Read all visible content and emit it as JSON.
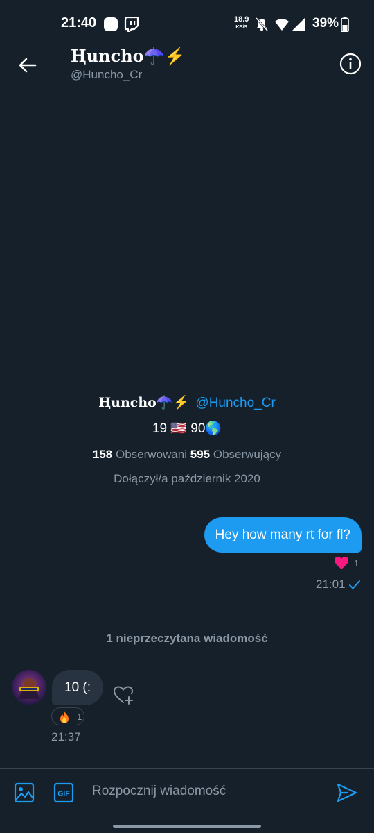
{
  "status_bar": {
    "time": "21:40",
    "net_speed_value": "18.9",
    "net_speed_unit": "KB/S",
    "battery": "39%"
  },
  "header": {
    "name": "Ⱨuncho☂️⚡",
    "handle": "@Huncho_Cr"
  },
  "profile": {
    "name": "Ⱨuncho☂️⚡",
    "handle": "@Huncho_Cr",
    "bio": "19 🇺🇸 90🌎",
    "following_count": "158",
    "following_label": "Obserwowani",
    "followers_count": "595",
    "followers_label": "Obserwujący",
    "joined": "Dołączył/a październik 2020"
  },
  "messages": {
    "sent": {
      "text": "Hey how many rt for fl?",
      "reaction_count": "1",
      "time": "21:01"
    },
    "unread_divider": "1 nieprzeczytana wiadomość",
    "received": {
      "text": "10 (:",
      "reaction_emoji": "🔥",
      "reaction_count": "1",
      "time": "21:37"
    }
  },
  "composer": {
    "placeholder": "Rozpocznij wiadomość",
    "gif_label": "GIF"
  },
  "colors": {
    "background": "#15202b",
    "accent": "#1d9bf0",
    "muted_text": "#8b98a5",
    "divider": "#38444d",
    "incoming_bubble": "#273340",
    "heart": "#f91880"
  },
  "icons": {
    "back": "arrow-left-icon",
    "info": "info-icon",
    "image": "image-icon",
    "gif": "gif-icon",
    "send": "send-icon",
    "add_reaction": "heart-plus-icon",
    "read_receipt": "check-icon"
  }
}
